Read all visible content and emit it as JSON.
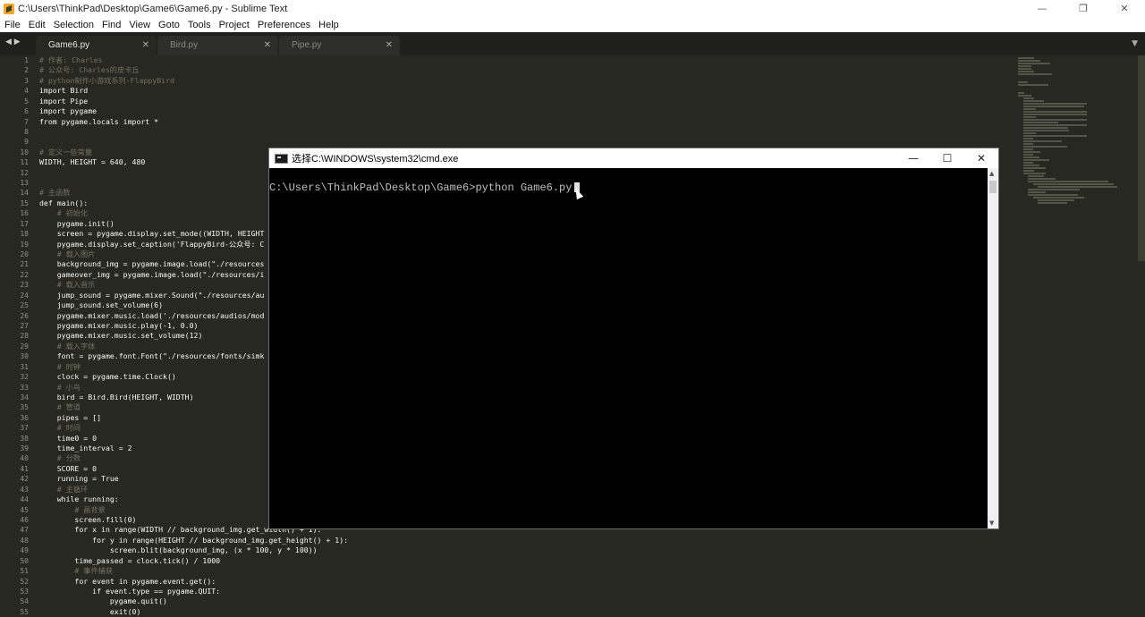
{
  "window": {
    "title": "C:\\Users\\ThinkPad\\Desktop\\Game6\\Game6.py - Sublime Text",
    "controls": [
      "—",
      "❐",
      "✕"
    ]
  },
  "menu": [
    "File",
    "Edit",
    "Selection",
    "Find",
    "View",
    "Goto",
    "Tools",
    "Project",
    "Preferences",
    "Help"
  ],
  "tabs": [
    {
      "label": "Game6.py",
      "active": true
    },
    {
      "label": "Bird.py",
      "active": false
    },
    {
      "label": "Pipe.py",
      "active": false
    }
  ],
  "tab_close": "✕",
  "tab_nav": "◀ ▶",
  "tab_dropdown": "▼",
  "code_lines": [
    "# 作者: Charles",
    "# 公众号: Charles的皮卡丘",
    "# python制作小游戏系列-FlappyBird",
    "import Bird",
    "import Pipe",
    "import pygame",
    "from pygame.locals import *",
    "",
    "",
    "# 定义一些常量",
    "WIDTH, HEIGHT = 640, 480",
    "",
    "",
    "# 主函数",
    "def main():",
    "    # 初始化",
    "    pygame.init()",
    "    screen = pygame.display.set_mode((WIDTH, HEIGHT",
    "    pygame.display.set_caption('FlappyBird-公众号: C",
    "    # 载入图片",
    "    background_img = pygame.image.load(\"./resources",
    "    gameover_img = pygame.image.load(\"./resources/i",
    "    # 载入音乐",
    "    jump_sound = pygame.mixer.Sound(\"./resources/au",
    "    jump_sound.set_volume(6)",
    "    pygame.mixer.music.load('./resources/audios/mod",
    "    pygame.mixer.music.play(-1, 0.0)",
    "    pygame.mixer.music.set_volume(12)",
    "    # 载入字体",
    "    font = pygame.font.Font(\"./resources/fonts/simk",
    "    # 时钟",
    "    clock = pygame.time.Clock()",
    "    # 小鸟",
    "    bird = Bird.Bird(HEIGHT, WIDTH)",
    "    # 管道",
    "    pipes = []",
    "    # 时间",
    "    time0 = 0",
    "    time_interval = 2",
    "    # 分数",
    "    SCORE = 0",
    "    running = True",
    "    # 主循环",
    "    while running:",
    "        # 画背景",
    "        screen.fill(0)",
    "        for x in range(WIDTH // background_img.get_width() + 1):",
    "            for y in range(HEIGHT // background_img.get_height() + 1):",
    "                screen.blit(background_img, (x * 100, y * 100))",
    "        time_passed = clock.tick() / 1000",
    "        # 事件捕获",
    "        for event in pygame.event.get():",
    "            if event.type == pygame.QUIT:",
    "                pygame.quit()",
    "                exit(0)"
  ],
  "cmd": {
    "title": "选择C:\\WINDOWS\\system32\\cmd.exe",
    "prompt": "C:\\Users\\ThinkPad\\Desktop\\Game6>python Game6.py",
    "controls": [
      "—",
      "☐",
      "✕"
    ]
  }
}
